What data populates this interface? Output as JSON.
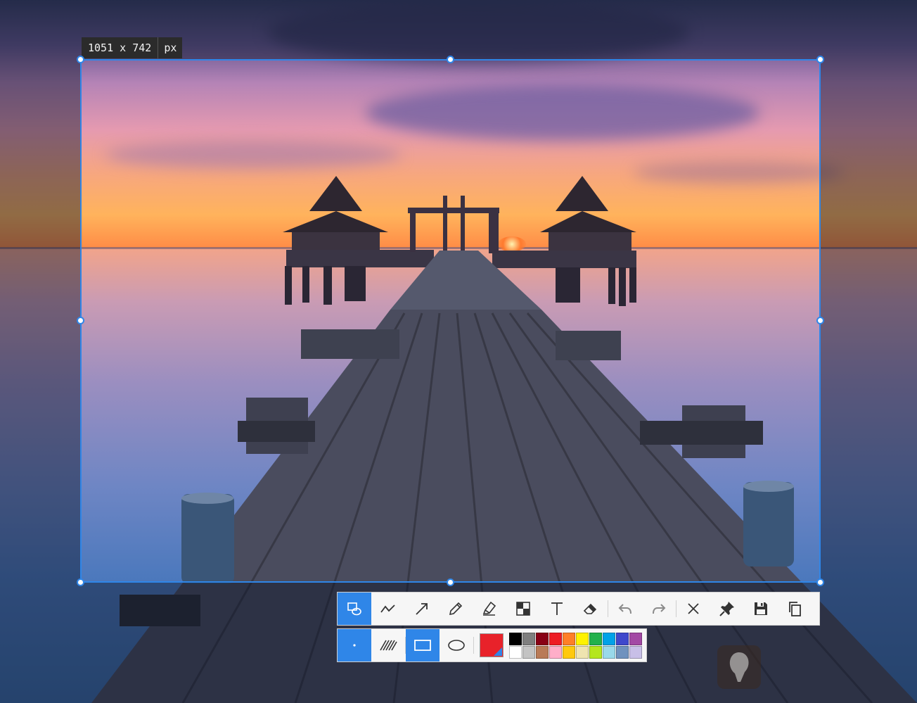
{
  "selection": {
    "width_label": "1051 x 742",
    "unit_label": "px"
  },
  "toolbar": {
    "tools": [
      {
        "name": "shape-tool",
        "icon": "shape-icon",
        "active": true
      },
      {
        "name": "line-tool",
        "icon": "polyline-icon",
        "active": false
      },
      {
        "name": "arrow-tool",
        "icon": "arrow-icon",
        "active": false
      },
      {
        "name": "pencil-tool",
        "icon": "pencil-icon",
        "active": false
      },
      {
        "name": "marker-tool",
        "icon": "highlighter-icon",
        "active": false
      },
      {
        "name": "mosaic-tool",
        "icon": "mosaic-icon",
        "active": false
      },
      {
        "name": "text-tool",
        "icon": "text-icon",
        "active": false
      },
      {
        "name": "eraser-tool",
        "icon": "eraser-icon",
        "active": false
      },
      {
        "name": "undo-button",
        "icon": "undo-icon",
        "active": false
      },
      {
        "name": "redo-button",
        "icon": "redo-icon",
        "active": false
      },
      {
        "name": "cancel-button",
        "icon": "close-icon",
        "active": false
      },
      {
        "name": "pin-button",
        "icon": "pin-icon",
        "active": false
      },
      {
        "name": "save-button",
        "icon": "save-icon",
        "active": false
      },
      {
        "name": "copy-button",
        "icon": "copy-icon",
        "active": false
      }
    ]
  },
  "subbar": {
    "options": [
      {
        "name": "stroke-size-option",
        "icon": "dot-icon",
        "active": true
      },
      {
        "name": "fill-pattern-option",
        "icon": "hatch-icon",
        "active": false
      },
      {
        "name": "rectangle-shape-option",
        "icon": "rectangle-icon",
        "active": true
      },
      {
        "name": "ellipse-shape-option",
        "icon": "ellipse-icon",
        "active": false
      }
    ],
    "current_color": "#e8222a",
    "palette": [
      "#000000",
      "#7f7f7f",
      "#880015",
      "#ed1c24",
      "#ff7f27",
      "#fff200",
      "#22b14c",
      "#00a2e8",
      "#3f48cc",
      "#a349a4",
      "#ffffff",
      "#c3c3c3",
      "#b97a57",
      "#ffaec9",
      "#ffc90e",
      "#efe4b0",
      "#b5e61d",
      "#99d9ea",
      "#7092be",
      "#c8bfe7"
    ]
  },
  "colors": {
    "accent": "#2f86e8"
  }
}
